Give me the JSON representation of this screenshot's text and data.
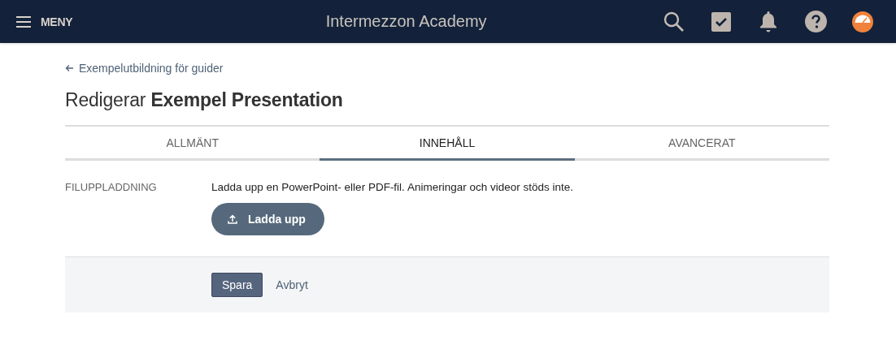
{
  "header": {
    "menu_label": "MENY",
    "title": "Intermezzon Academy"
  },
  "breadcrumb": {
    "label": "Exempelutbildning för guider"
  },
  "page_title": "Redigerar **Exempel Presentation**",
  "tabs": [
    {
      "label": "ALLMÄNT",
      "selected": false
    },
    {
      "label": "INNEHÅLL",
      "selected": true
    },
    {
      "label": "AVANCERAT",
      "selected": false
    }
  ],
  "section": {
    "label": "FILUPPLADDNING",
    "description": "Ladda upp en PowerPoint- eller PDF-fil. Animeringar och videor stöds inte.",
    "upload_button": "Ladda upp"
  },
  "footer": {
    "save_button": "Spara",
    "cancel_link": "Avbryt"
  }
}
